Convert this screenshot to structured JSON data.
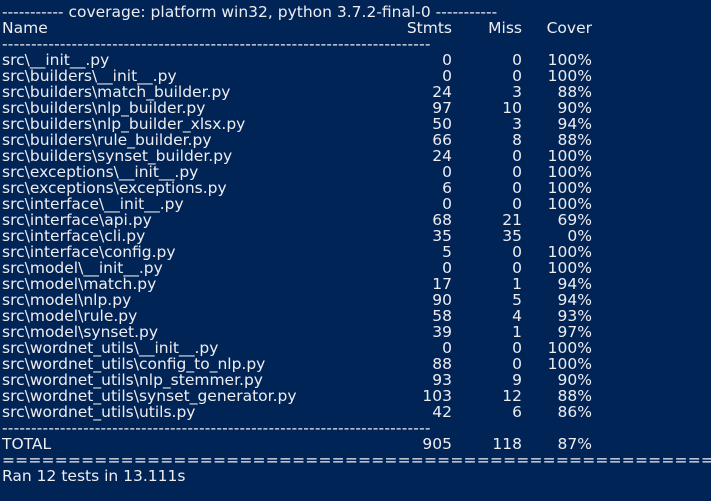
{
  "terminal": {
    "banner": "----------- coverage: platform win32, python 3.7.2-final-0 -----------",
    "headers": {
      "name": "Name",
      "stmts": "Stmts",
      "miss": "Miss",
      "cover": "Cover"
    },
    "separator": "--------------------------------------------------------------------------",
    "rows": [
      {
        "name": "src\\__init__.py",
        "stmts": "0",
        "miss": "0",
        "cover": "100%"
      },
      {
        "name": "src\\builders\\__init__.py",
        "stmts": "0",
        "miss": "0",
        "cover": "100%"
      },
      {
        "name": "src\\builders\\match_builder.py",
        "stmts": "24",
        "miss": "3",
        "cover": "88%"
      },
      {
        "name": "src\\builders\\nlp_builder.py",
        "stmts": "97",
        "miss": "10",
        "cover": "90%"
      },
      {
        "name": "src\\builders\\nlp_builder_xlsx.py",
        "stmts": "50",
        "miss": "3",
        "cover": "94%"
      },
      {
        "name": "src\\builders\\rule_builder.py",
        "stmts": "66",
        "miss": "8",
        "cover": "88%"
      },
      {
        "name": "src\\builders\\synset_builder.py",
        "stmts": "24",
        "miss": "0",
        "cover": "100%"
      },
      {
        "name": "src\\exceptions\\__init__.py",
        "stmts": "0",
        "miss": "0",
        "cover": "100%"
      },
      {
        "name": "src\\exceptions\\exceptions.py",
        "stmts": "6",
        "miss": "0",
        "cover": "100%"
      },
      {
        "name": "src\\interface\\__init__.py",
        "stmts": "0",
        "miss": "0",
        "cover": "100%"
      },
      {
        "name": "src\\interface\\api.py",
        "stmts": "68",
        "miss": "21",
        "cover": "69%"
      },
      {
        "name": "src\\interface\\cli.py",
        "stmts": "35",
        "miss": "35",
        "cover": "0%"
      },
      {
        "name": "src\\interface\\config.py",
        "stmts": "5",
        "miss": "0",
        "cover": "100%"
      },
      {
        "name": "src\\model\\__init__.py",
        "stmts": "0",
        "miss": "0",
        "cover": "100%"
      },
      {
        "name": "src\\model\\match.py",
        "stmts": "17",
        "miss": "1",
        "cover": "94%"
      },
      {
        "name": "src\\model\\nlp.py",
        "stmts": "90",
        "miss": "5",
        "cover": "94%"
      },
      {
        "name": "src\\model\\rule.py",
        "stmts": "58",
        "miss": "4",
        "cover": "93%"
      },
      {
        "name": "src\\model\\synset.py",
        "stmts": "39",
        "miss": "1",
        "cover": "97%"
      },
      {
        "name": "src\\wordnet_utils\\__init__.py",
        "stmts": "0",
        "miss": "0",
        "cover": "100%"
      },
      {
        "name": "src\\wordnet_utils\\config_to_nlp.py",
        "stmts": "88",
        "miss": "0",
        "cover": "100%"
      },
      {
        "name": "src\\wordnet_utils\\nlp_stemmer.py",
        "stmts": "93",
        "miss": "9",
        "cover": "90%"
      },
      {
        "name": "src\\wordnet_utils\\synset_generator.py",
        "stmts": "103",
        "miss": "12",
        "cover": "88%"
      },
      {
        "name": "src\\wordnet_utils\\utils.py",
        "stmts": "42",
        "miss": "6",
        "cover": "86%"
      }
    ],
    "total": {
      "name": "TOTAL",
      "stmts": "905",
      "miss": "118",
      "cover": "87%"
    },
    "footer_separator": "================================================================================",
    "summary": "Ran 12 tests in 13.111s"
  }
}
